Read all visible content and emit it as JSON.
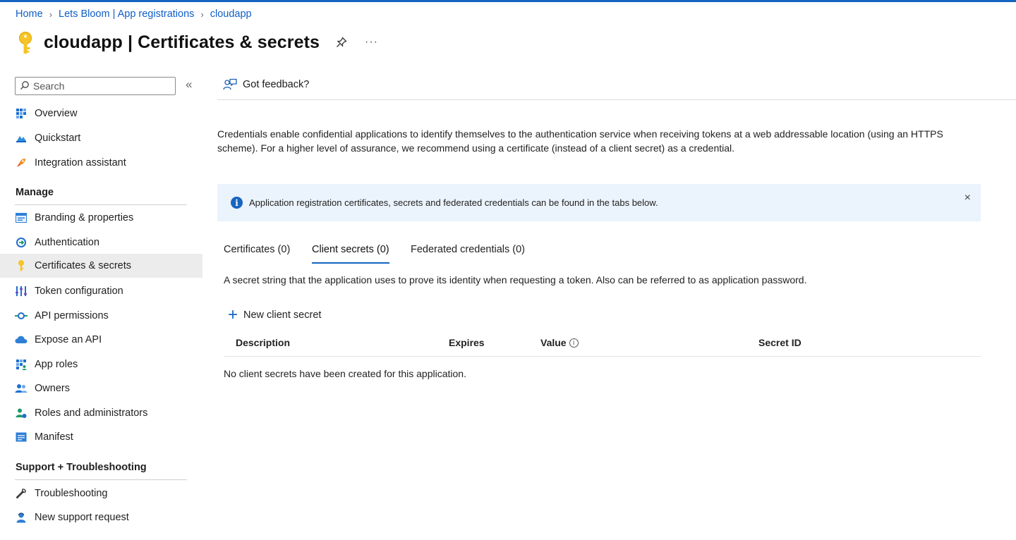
{
  "breadcrumb": {
    "items": [
      "Home",
      "Lets Bloom | App registrations",
      "cloudapp"
    ]
  },
  "header": {
    "app_name": "cloudapp",
    "page_name": "| Certificates & secrets",
    "more": "···"
  },
  "sidebar": {
    "search_placeholder": "Search",
    "collapse_label": "«",
    "top_items": [
      {
        "label": "Overview",
        "icon": "overview-grid-icon"
      },
      {
        "label": "Quickstart",
        "icon": "quickstart-cloud-icon"
      },
      {
        "label": "Integration assistant",
        "icon": "rocket-icon"
      }
    ],
    "manage_heading": "Manage",
    "manage_items": [
      {
        "label": "Branding & properties",
        "icon": "branding-icon"
      },
      {
        "label": "Authentication",
        "icon": "authentication-icon"
      },
      {
        "label": "Certificates & secrets",
        "icon": "key-icon",
        "active": true
      },
      {
        "label": "Token configuration",
        "icon": "token-bars-icon"
      },
      {
        "label": "API permissions",
        "icon": "api-permissions-icon"
      },
      {
        "label": "Expose an API",
        "icon": "cloud-icon"
      },
      {
        "label": "App roles",
        "icon": "app-roles-grid-icon"
      },
      {
        "label": "Owners",
        "icon": "owners-people-icon"
      },
      {
        "label": "Roles and administrators",
        "icon": "roles-admin-icon"
      },
      {
        "label": "Manifest",
        "icon": "manifest-icon"
      }
    ],
    "support_heading": "Support + Troubleshooting",
    "support_items": [
      {
        "label": "Troubleshooting",
        "icon": "wrench-icon"
      },
      {
        "label": "New support request",
        "icon": "support-person-icon"
      }
    ]
  },
  "main": {
    "feedback_label": "Got feedback?",
    "description": "Credentials enable confidential applications to identify themselves to the authentication service when receiving tokens at a web addressable location (using an HTTPS scheme). For a higher level of assurance, we recommend using a certificate (instead of a client secret) as a credential.",
    "info_message": "Application registration certificates, secrets and federated credentials can be found in the tabs below.",
    "info_close": "×",
    "tabs": [
      {
        "label": "Certificates (0)"
      },
      {
        "label": "Client secrets (0)",
        "active": true
      },
      {
        "label": "Federated credentials (0)"
      }
    ],
    "tab_description": "A secret string that the application uses to prove its identity when requesting a token. Also can be referred to as application password.",
    "new_secret_label": "New client secret",
    "table_headers": [
      "Description",
      "Expires",
      "Value",
      "Secret ID"
    ],
    "empty_message": "No client secrets have been created for this application."
  },
  "colors": {
    "accent": "#1565c0",
    "link": "#0f5ec7",
    "info_bg": "#ebf3fc",
    "active_nav_bg": "#ececec"
  }
}
